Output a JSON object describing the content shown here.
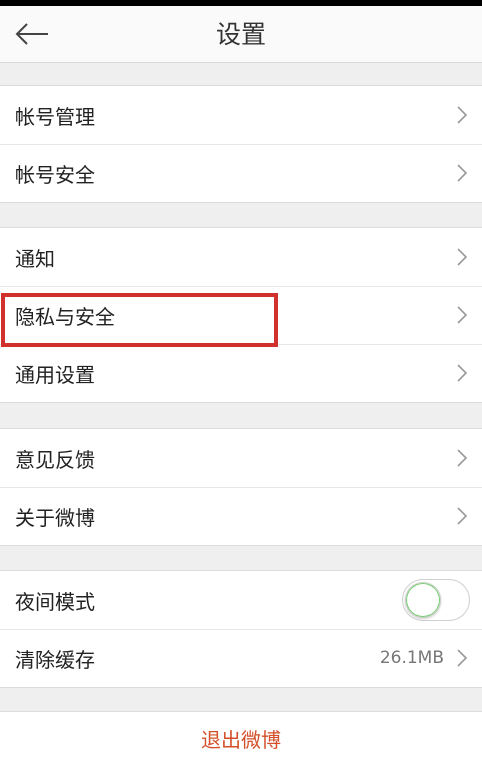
{
  "header": {
    "title": "设置",
    "back_icon": "arrow-left-icon"
  },
  "groups": [
    {
      "items": [
        {
          "label": "帐号管理"
        },
        {
          "label": "帐号安全"
        }
      ]
    },
    {
      "items": [
        {
          "label": "通知"
        },
        {
          "label": "隐私与安全"
        },
        {
          "label": "通用设置"
        }
      ]
    },
    {
      "items": [
        {
          "label": "意见反馈"
        },
        {
          "label": "关于微博"
        }
      ]
    },
    {
      "items": [
        {
          "label": "夜间模式",
          "toggle_on": false
        },
        {
          "label": "清除缓存",
          "value": "26.1MB"
        }
      ]
    }
  ],
  "logout": {
    "label": "退出微博"
  },
  "colors": {
    "accent": "#d4502a",
    "highlight": "#d0312d",
    "toggle_ring": "#6fcf6a"
  }
}
